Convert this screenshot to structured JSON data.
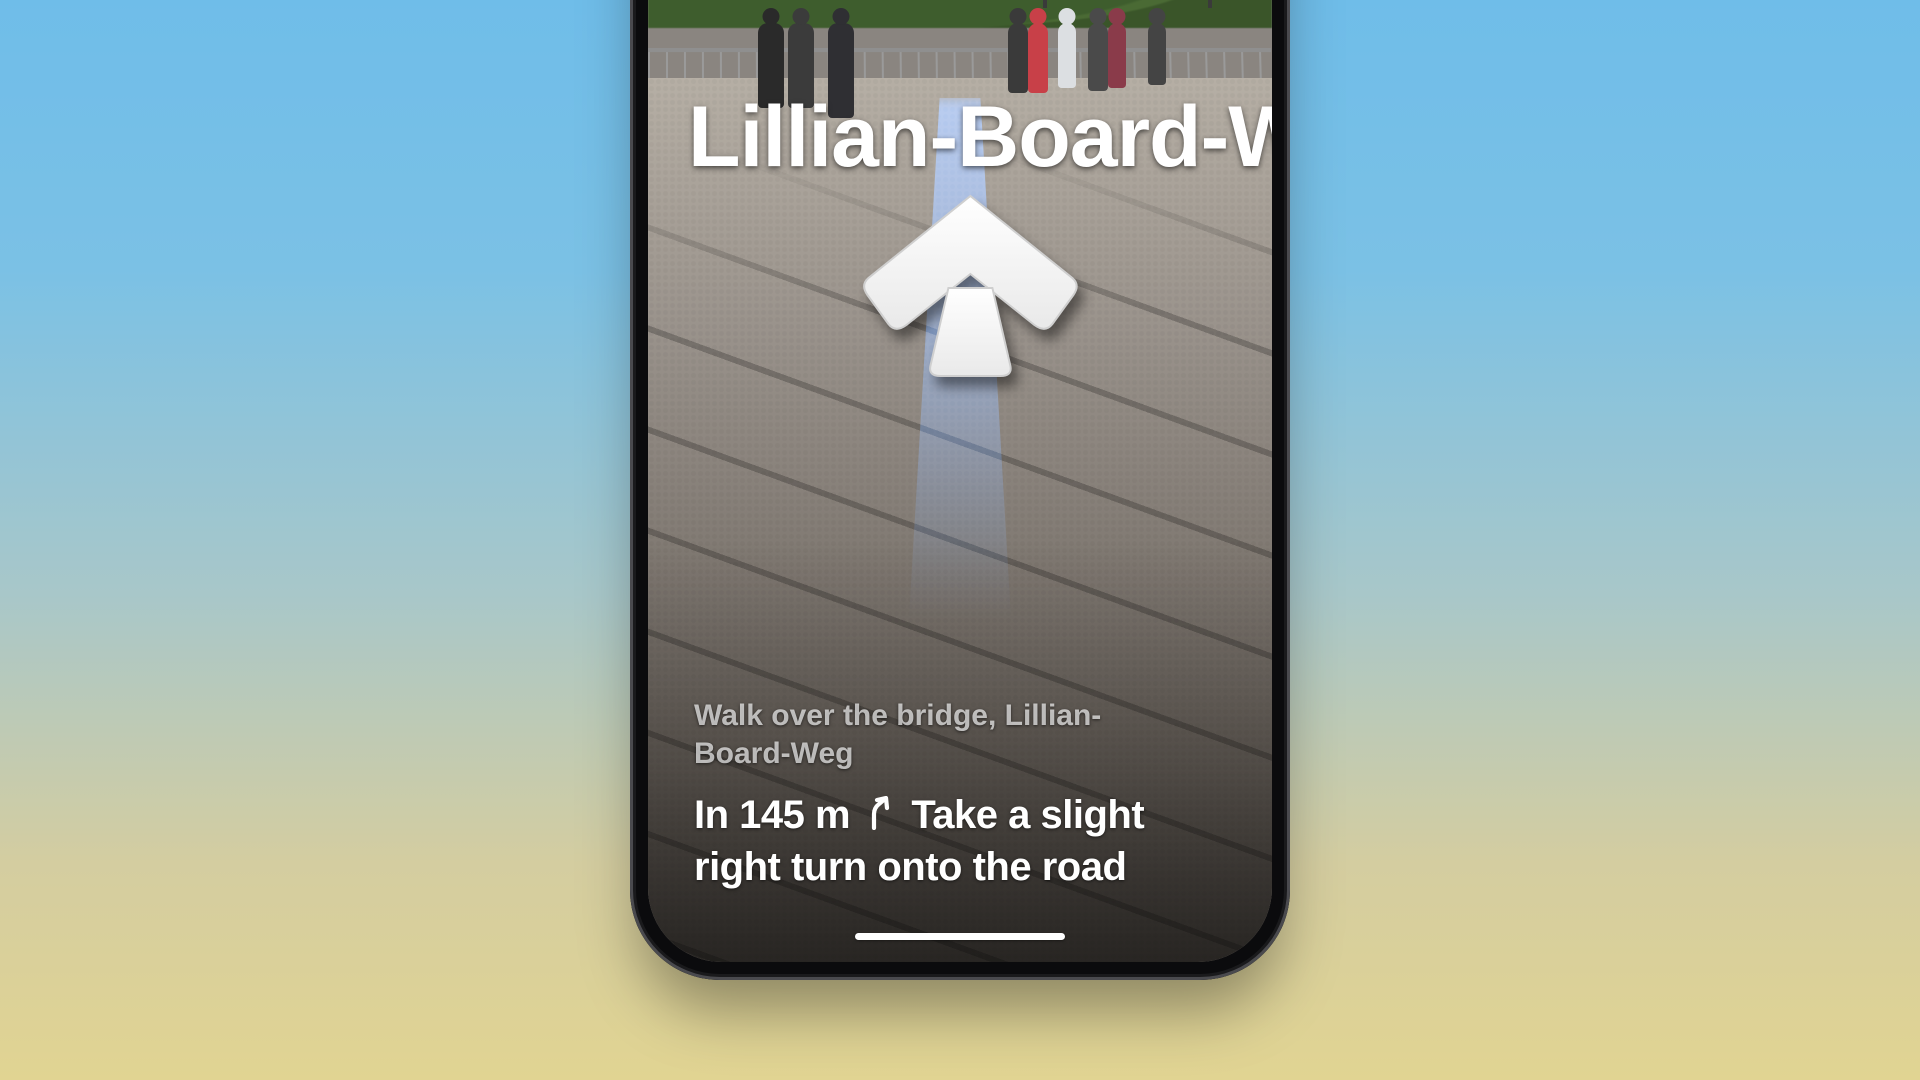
{
  "ar": {
    "street_label": "Lillian-Board-We",
    "arrow_icon": "ar-forward-arrow-icon"
  },
  "directions": {
    "current_step": "Walk over the bridge, Lillian-Board-Weg",
    "next_distance_prefix": "In 145 m",
    "next_turn_icon": "slight-right-arrow-icon",
    "next_instruction_suffix": "Take a slight right turn onto the road"
  }
}
